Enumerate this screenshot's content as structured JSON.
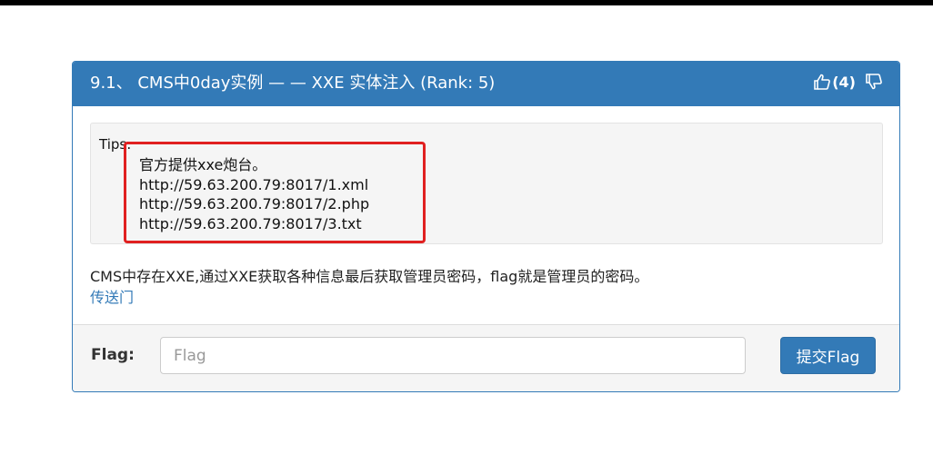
{
  "challenge": {
    "title": "9.1、 CMS中0day实例 — — XXE 实体注入  (Rank: 5)",
    "likes": "(4)"
  },
  "tips": {
    "label": "Tips:",
    "lines": [
      "官方提供xxe炮台。",
      "http://59.63.200.79:8017/1.xml",
      "http://59.63.200.79:8017/2.php",
      "http://59.63.200.79:8017/3.txt"
    ]
  },
  "description": "CMS中存在XXE,通过XXE获取各种信息最后获取管理员密码，flag就是管理员的密码。",
  "portal_link": "传送门",
  "form": {
    "label": "Flag:",
    "placeholder": "Flag",
    "value": "",
    "submit_label": "提交Flag"
  },
  "colors": {
    "primary": "#337ab7",
    "highlight": "#e02020",
    "well": "#f5f5f5"
  },
  "icons": {
    "like": "thumbs-up-icon",
    "dislike": "thumbs-down-icon"
  }
}
